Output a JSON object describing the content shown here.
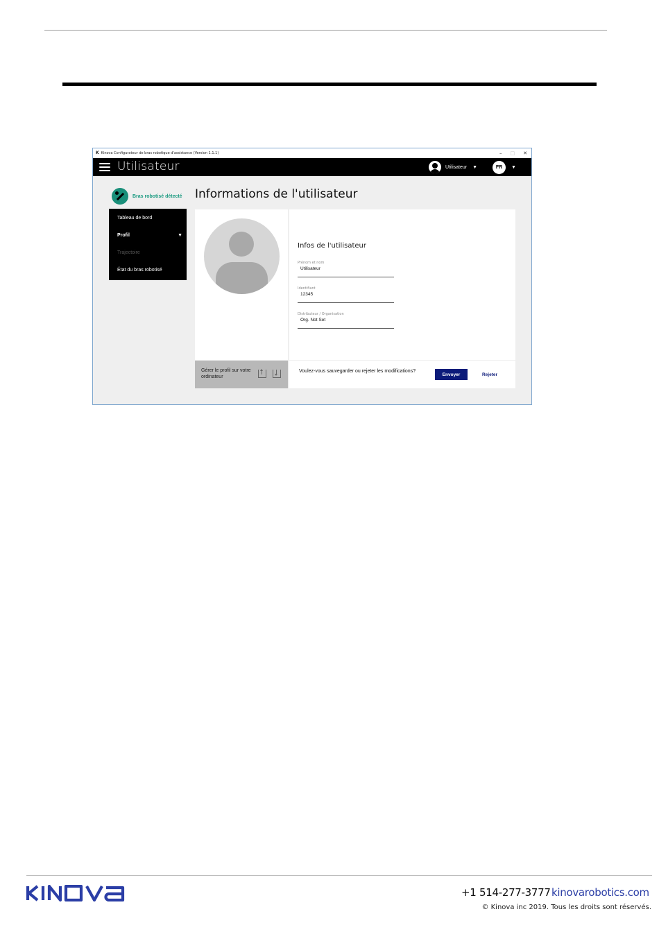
{
  "window": {
    "title": "Kinova Configurateur de bras robotique d'assistance (Version 1.1.1)",
    "logo_letter": "K",
    "controls": [
      "–",
      "□",
      "✕"
    ]
  },
  "appbar": {
    "title": "Utilisateur",
    "user_label": "Utilisateur",
    "lang": "FR"
  },
  "sidebar": {
    "robot_status": "Bras robotisé détecté",
    "items": [
      {
        "label": "Tableau de bord",
        "state": "normal"
      },
      {
        "label": "Profil",
        "state": "active"
      },
      {
        "label": "Trajectoire",
        "state": "disabled"
      },
      {
        "label": "État du bras robotisé",
        "state": "normal"
      }
    ]
  },
  "main": {
    "title": "Informations de l'utilisateur",
    "info_title": "Infos de l'utilisateur",
    "fields": [
      {
        "label": "Prénom et nom",
        "value": "Utilisateur"
      },
      {
        "label": "Identifiant",
        "value": "12345"
      },
      {
        "label": "Distributeur / Organisation",
        "value": "Org. Not Set"
      }
    ],
    "manage_label": "Gérer le profil sur votre ordinateur",
    "save_prompt": "Voulez-vous sauvegarder ou rejeter les modifications?",
    "send_label": "Envoyer",
    "reject_label": "Rejeter"
  },
  "footer": {
    "brand": "KINOVA",
    "phone": "+1 514-277-3777",
    "website": "kinovarobotics.com",
    "copyright": "© Kinova inc 2019. Tous les droits sont réservés."
  },
  "colors": {
    "accent": "#0c1b7a",
    "robot_status": "#1a9a80",
    "brand": "#2b3ea6"
  }
}
